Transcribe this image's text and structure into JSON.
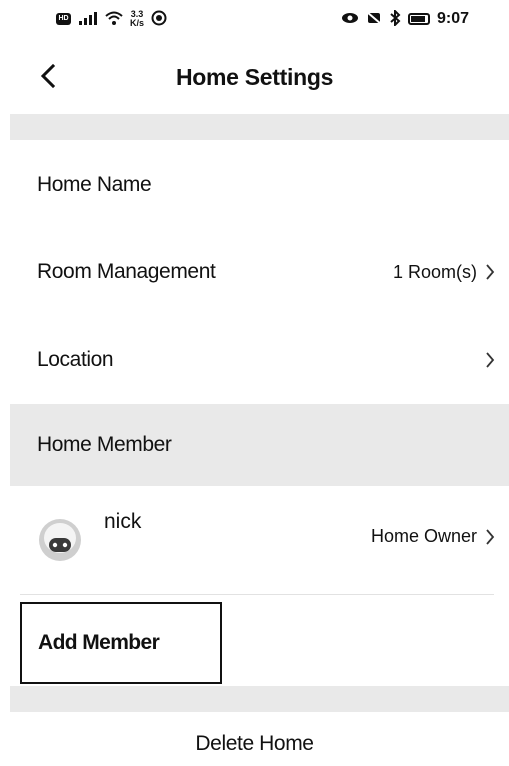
{
  "status_bar": {
    "hd": "HD",
    "signal": "⁴ᴳ",
    "net_speed_value": "3.3",
    "net_speed_unit": "K/s",
    "time": "9:07"
  },
  "header": {
    "title": "Home Settings"
  },
  "rows": {
    "home_name": {
      "label": "Home Name"
    },
    "room_management": {
      "label": "Room Management",
      "value": "1 Room(s)"
    },
    "location": {
      "label": "Location"
    }
  },
  "members": {
    "section_title": "Home Member",
    "items": [
      {
        "name": "nick",
        "role": "Home Owner"
      }
    ],
    "add_label": "Add Member"
  },
  "footer": {
    "delete_label": "Delete Home"
  },
  "colors": {
    "band": "#e9e9e9",
    "text": "#111111",
    "background": "#ffffff"
  }
}
